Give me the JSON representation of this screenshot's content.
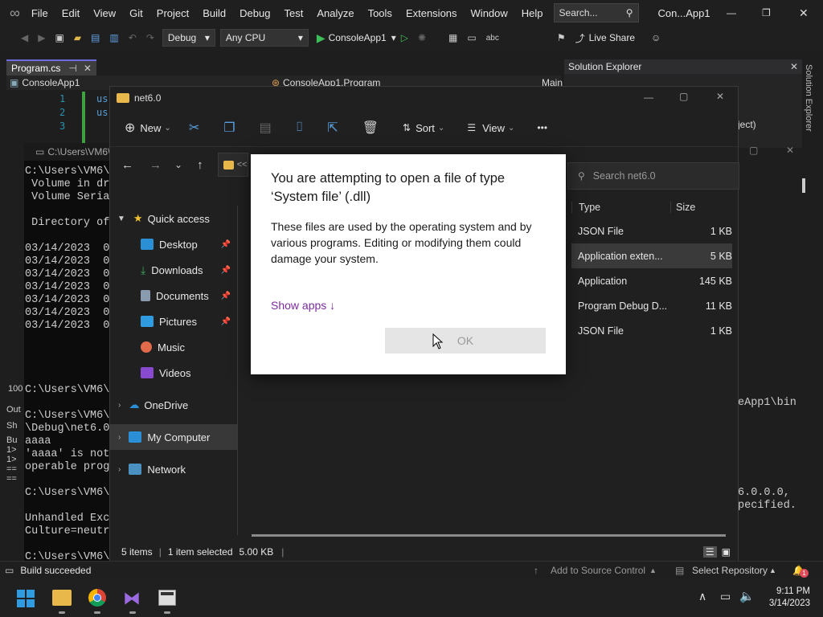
{
  "vs": {
    "menu": [
      "File",
      "Edit",
      "View",
      "Git",
      "Project",
      "Build",
      "Debug",
      "Test",
      "Analyze",
      "Tools",
      "Extensions",
      "Window",
      "Help"
    ],
    "search_placeholder": "Search...",
    "window_title": "Con...App1",
    "config": "Debug",
    "platform": "Any CPU",
    "run_target": "ConsoleApp1",
    "live_share": "Live Share",
    "tab_program": "Program.cs",
    "project_dropdown": "ConsoleApp1",
    "class_dropdown": "ConsoleApp1.Program",
    "member_dropdown": "Main",
    "line_numbers": [
      "1",
      "2",
      "3"
    ],
    "code_lines": [
      "us",
      "us",
      ""
    ],
    "solution_explorer_title": "Solution Explorer",
    "solution_explorer_side": "Solution Explorer",
    "solution_item": "ject)",
    "zoom": "100",
    "output_label": "Out",
    "output_show": "Sh",
    "output_lines": [
      "Bu",
      "1>",
      "1>",
      "==",
      "=="
    ],
    "status_left": "Build succeeded",
    "status_source": "Add to Source Control",
    "status_repo": "Select Repository",
    "notify_count": "1"
  },
  "console": {
    "title": "C:\\Users\\VM6\\",
    "lines": [
      "C:\\Users\\VM6\\",
      " Volume in dr",
      " Volume Seria",
      "",
      " Directory of",
      "",
      "03/14/2023  0",
      "03/14/2023  0",
      "03/14/2023  0",
      "03/14/2023  0",
      "03/14/2023  0",
      "03/14/2023  0",
      "03/14/2023  0",
      "",
      "",
      "",
      "",
      "C:\\Users\\VM6\\",
      "",
      "C:\\Users\\VM6\\",
      "\\Debug\\net6.0",
      "aaaa",
      "'aaaa' is not",
      "operable prog",
      "",
      "C:\\Users\\VM6\\",
      "",
      "Unhandled Exc",
      "Culture=neutr",
      "",
      "C:\\Users\\VM6\\"
    ],
    "right_lines": [
      "eApp1\\bin",
      "",
      "",
      "",
      "",
      "",
      "",
      "6.0.0.0,",
      "pecified."
    ]
  },
  "explorer": {
    "title": "net6.0",
    "toolbar": {
      "new": "New",
      "sort": "Sort",
      "view": "View",
      "more": "•••"
    },
    "address": "<<",
    "search_placeholder": "Search net6.0",
    "nav": {
      "quick_access": "Quick access",
      "items": [
        {
          "label": "Desktop",
          "color": "#2b8fd6"
        },
        {
          "label": "Downloads",
          "color": "#3aa55a"
        },
        {
          "label": "Documents",
          "color": "#8a9bb0"
        },
        {
          "label": "Pictures",
          "color": "#2f9be0"
        },
        {
          "label": "Music",
          "color": "#e06a4a"
        },
        {
          "label": "Videos",
          "color": "#8a4ad0"
        }
      ],
      "onedrive": "OneDrive",
      "my_computer": "My Computer",
      "network": "Network"
    },
    "columns": {
      "type": "Type",
      "size": "Size"
    },
    "files": [
      {
        "type": "JSON File",
        "size": "1 KB"
      },
      {
        "type": "Application exten...",
        "size": "5 KB"
      },
      {
        "type": "Application",
        "size": "145 KB"
      },
      {
        "type": "Program Debug D...",
        "size": "11 KB"
      },
      {
        "type": "JSON File",
        "size": "1 KB"
      }
    ],
    "status": {
      "items": "5 items",
      "selected": "1 item selected",
      "size": "5.00 KB"
    }
  },
  "dialog": {
    "title": "You are attempting to open a file of type ‘System file’ (.dll)",
    "body": "These files are used by the operating system and by various programs. Editing or modifying them could damage your system.",
    "show_apps": "Show apps ↓",
    "ok": "OK"
  },
  "taskbar": {
    "time": "9:11 PM",
    "date": "3/14/2023"
  }
}
